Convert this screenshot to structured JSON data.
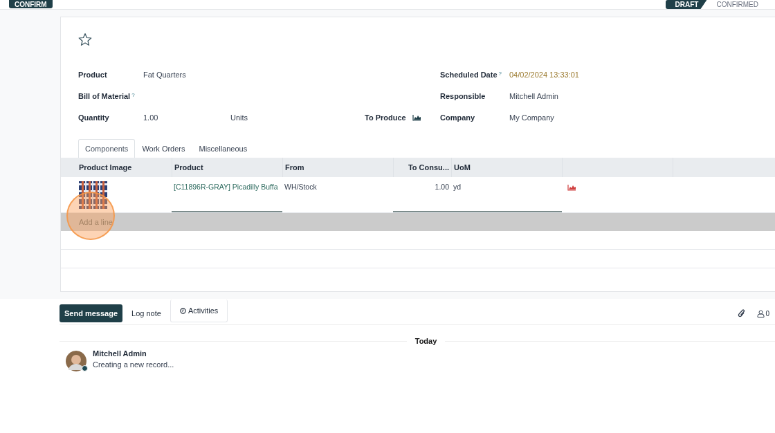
{
  "control_bar": {
    "confirm_button": "CONFIRM",
    "stages": [
      {
        "label": "DRAFT",
        "selected": true
      },
      {
        "label": "CONFIRMED",
        "selected": false
      }
    ]
  },
  "form": {
    "starred": false,
    "left_fields": [
      {
        "label": "Product",
        "help": false,
        "value": "Fat Quarters"
      },
      {
        "label": "Bill of Material",
        "help": true
      },
      {
        "label": "Quantity",
        "help": false,
        "value": "1.00",
        "unit": "Units"
      }
    ],
    "to_produce": "To Produce",
    "right_fields": [
      {
        "label": "Scheduled Date",
        "help": true,
        "value": "04/02/2024 13:33:01",
        "kind": "date"
      },
      {
        "label": "Responsible",
        "help": false,
        "value": "Mitchell Admin",
        "kind": "text"
      },
      {
        "label": "Company",
        "help": false,
        "value": "My Company",
        "kind": "text"
      }
    ],
    "help_mark": "?",
    "tabs": [
      {
        "label": "Components",
        "selected": true
      },
      {
        "label": "Work Orders",
        "selected": false
      },
      {
        "label": "Miscellaneous",
        "selected": false
      }
    ],
    "table": {
      "columns": [
        "Product Image",
        "Product",
        "From",
        "To Consu...",
        "UoM"
      ],
      "rows": [
        {
          "product": "[C11896R-GRAY] Picadilly Buffa",
          "from": "WH/Stock",
          "to_consume": "1.00",
          "uom": "yd"
        }
      ],
      "add_line": "Add a line"
    }
  },
  "chatter": {
    "buttons": [
      {
        "label": "Send message",
        "kind": "primary"
      },
      {
        "label": "Log note",
        "kind": "plain"
      },
      {
        "label": "Activities",
        "kind": "boxed"
      }
    ],
    "followers": "0",
    "date_separator": "Today",
    "messages": [
      {
        "author": "Mitchell Admin",
        "body": "Creating a new record..."
      }
    ]
  }
}
